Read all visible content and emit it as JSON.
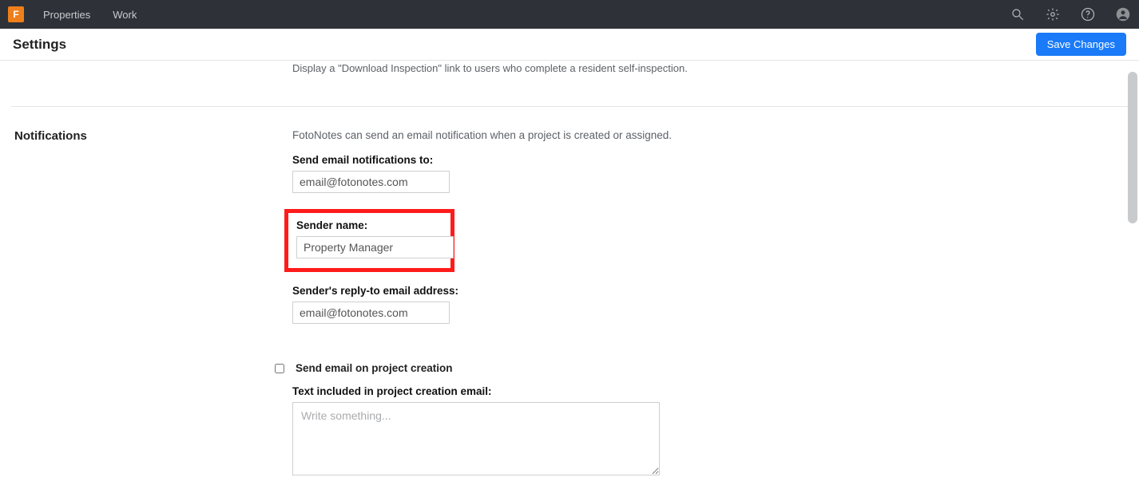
{
  "nav": {
    "logo_letter": "F",
    "links": [
      "Properties",
      "Work"
    ]
  },
  "subheader": {
    "title": "Settings",
    "save_label": "Save Changes"
  },
  "prev_section_text": "Display a \"Download Inspection\" link to users who complete a resident self-inspection.",
  "notifications": {
    "heading": "Notifications",
    "lead": "FotoNotes can send an email notification when a project is created or assigned.",
    "email_to_label": "Send email notifications to:",
    "email_to_value": "email@fotonotes.com",
    "sender_name_label": "Sender name:",
    "sender_name_value": "Property Manager",
    "reply_to_label": "Sender's reply-to email address:",
    "reply_to_value": "email@fotonotes.com",
    "send_on_create_label": "Send email on project creation",
    "creation_text_label": "Text included in project creation email:",
    "creation_text_placeholder": "Write something..."
  }
}
